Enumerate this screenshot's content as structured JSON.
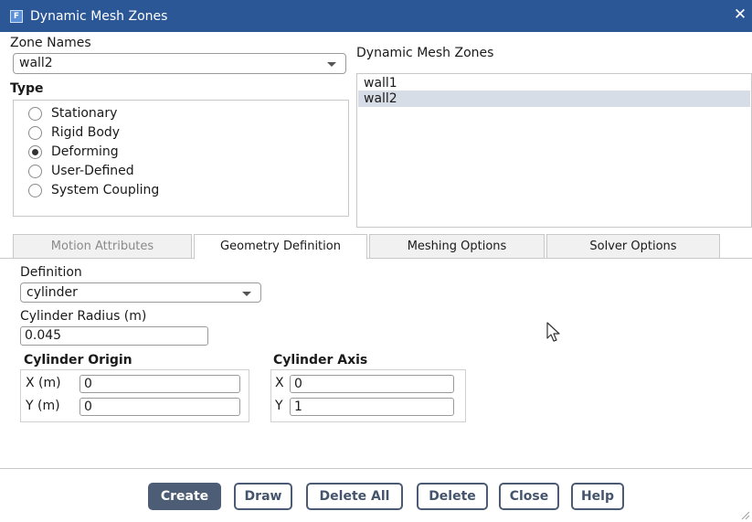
{
  "window": {
    "title": "Dynamic Mesh Zones",
    "app_icon_letter": "F",
    "close_symbol": "✕"
  },
  "zone_names": {
    "label": "Zone Names",
    "selected": "wall2"
  },
  "type": {
    "label": "Type",
    "options": [
      {
        "label": "Stationary",
        "checked": false
      },
      {
        "label": "Rigid Body",
        "checked": false
      },
      {
        "label": "Deforming",
        "checked": true
      },
      {
        "label": "User-Defined",
        "checked": false
      },
      {
        "label": "System Coupling",
        "checked": false
      }
    ]
  },
  "dynamic_mesh_zones": {
    "label": "Dynamic Mesh Zones",
    "items": [
      {
        "label": "wall1",
        "selected": false
      },
      {
        "label": "wall2",
        "selected": true
      }
    ]
  },
  "tabs": [
    {
      "label": "Motion Attributes",
      "state": "disabled"
    },
    {
      "label": "Geometry Definition",
      "state": "active"
    },
    {
      "label": "Meshing Options",
      "state": "normal"
    },
    {
      "label": "Solver Options",
      "state": "normal"
    }
  ],
  "geometry": {
    "definition_label": "Definition",
    "definition_value": "cylinder",
    "radius_label": "Cylinder Radius (m)",
    "radius_value": "0.045",
    "origin": {
      "label": "Cylinder Origin",
      "x_label": "X (m)",
      "x_value": "0",
      "y_label": "Y (m)",
      "y_value": "0"
    },
    "axis": {
      "label": "Cylinder Axis",
      "x_label": "X",
      "x_value": "0",
      "y_label": "Y",
      "y_value": "1"
    }
  },
  "buttons": {
    "create": "Create",
    "draw": "Draw",
    "delete_all": "Delete All",
    "delete": "Delete",
    "close": "Close",
    "help": "Help"
  },
  "colors": {
    "titlebar": "#2b5797",
    "primary_button": "#4d5d75",
    "selected_row": "#d7dde6"
  },
  "icons": [
    "app-icon",
    "close-icon",
    "dropdown-arrow-icon",
    "mouse-pointer-icon",
    "resize-grip-icon"
  ]
}
